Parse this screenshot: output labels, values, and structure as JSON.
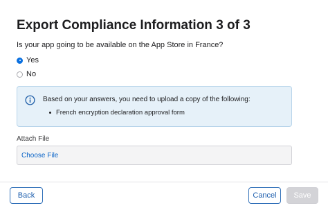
{
  "dialog": {
    "title": "Export Compliance Information 3 of 3",
    "question": "Is your app going to be available on the App Store in France?",
    "options": [
      {
        "label": "Yes",
        "selected": true
      },
      {
        "label": "No",
        "selected": false
      }
    ]
  },
  "info": {
    "icon": "info-circle-icon",
    "text": "Based on your answers, you need to upload a copy of the following:",
    "items": [
      "French encryption declaration approval form"
    ]
  },
  "attach": {
    "label": "Attach File",
    "button": "Choose File"
  },
  "footer": {
    "back": "Back",
    "cancel": "Cancel",
    "save": "Save",
    "save_enabled": false
  },
  "colors": {
    "accent": "#0a70e0",
    "info_bg": "#e6f1f9",
    "info_border": "#b7d4ea",
    "button_outline": "#2f6fb8",
    "disabled_button": "#d3d3d7"
  }
}
